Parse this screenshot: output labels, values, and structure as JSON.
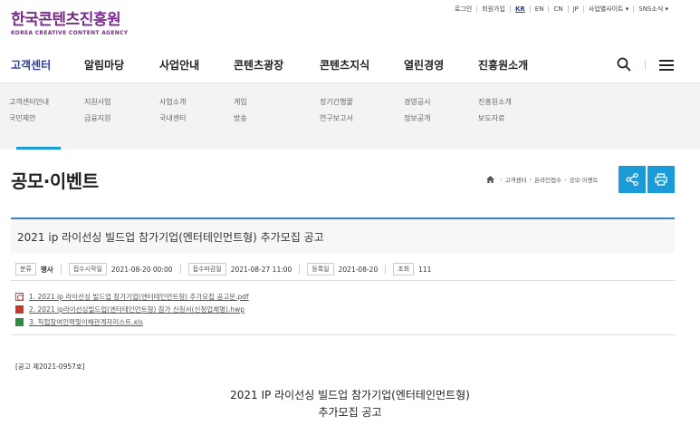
{
  "utility": {
    "items": [
      "로그인",
      "회원가입",
      "KR",
      "EN",
      "CN",
      "JP",
      "사업별사이트 ▾",
      "SNS소식 ▾"
    ]
  },
  "logo": {
    "ko": "한국콘텐츠진흥원",
    "en": "KOREA CREATIVE CONTENT AGENCY"
  },
  "nav": {
    "items": [
      "고객센터",
      "알림마당",
      "사업안내",
      "콘텐츠광장",
      "콘텐츠지식",
      "열린경영",
      "진흥원소개"
    ],
    "active_index": 0
  },
  "submenu": {
    "columns": [
      [
        "고객센터안내",
        "국민제안"
      ],
      [
        "지원사업",
        "금융지원"
      ],
      [
        "사업소개",
        "국내센터"
      ],
      [
        "게임",
        "방송"
      ],
      [
        "정기간행물",
        "연구보고서"
      ],
      [
        "경영공시",
        "정보공개"
      ],
      [
        "진흥원소개",
        "보도자료"
      ]
    ]
  },
  "page": {
    "title": "공모·이벤트",
    "breadcrumb": [
      "고객센터",
      "온라인접수",
      "공모·이벤트"
    ]
  },
  "article": {
    "title": "2021 ip 라이선싱 빌드업 참가기업(엔터테인먼트형) 추가모집 공고",
    "meta": {
      "category_label": "분류",
      "category": "행사",
      "start_label": "접수시작일",
      "start": "2021-08-20 00:00",
      "end_label": "접수마감일",
      "end": "2021-08-27 11:00",
      "reg_label": "등록일",
      "reg": "2021-08-20",
      "views_label": "조회",
      "views": "111"
    },
    "files": [
      {
        "name": "1. 2021 ip 라이선싱 빌드업 참가기업(엔터테인먼트형) 추가모집 공고문.pdf",
        "icon": "pdf-icon"
      },
      {
        "name": "2. 2021 ip라이선싱빌드업(엔터테인먼트형) 참가 신청서(신청업체명).hwp",
        "icon": "hwp-icon"
      },
      {
        "name": "3. 직접참여인력및이해관계자리스트.xls",
        "icon": "xls-icon"
      }
    ],
    "notice_no": "[공고 제2021-0957호]",
    "body_title_1": "2021 IP 라이선싱 빌드업 참가기업(엔터테인먼트형)",
    "body_title_2": "추가모집 공고"
  },
  "colors": {
    "brand": "#7a2a8c",
    "nav_active": "#2f3e9e",
    "accent": "#1a9bd7",
    "header_line": "#3b7fc4"
  }
}
